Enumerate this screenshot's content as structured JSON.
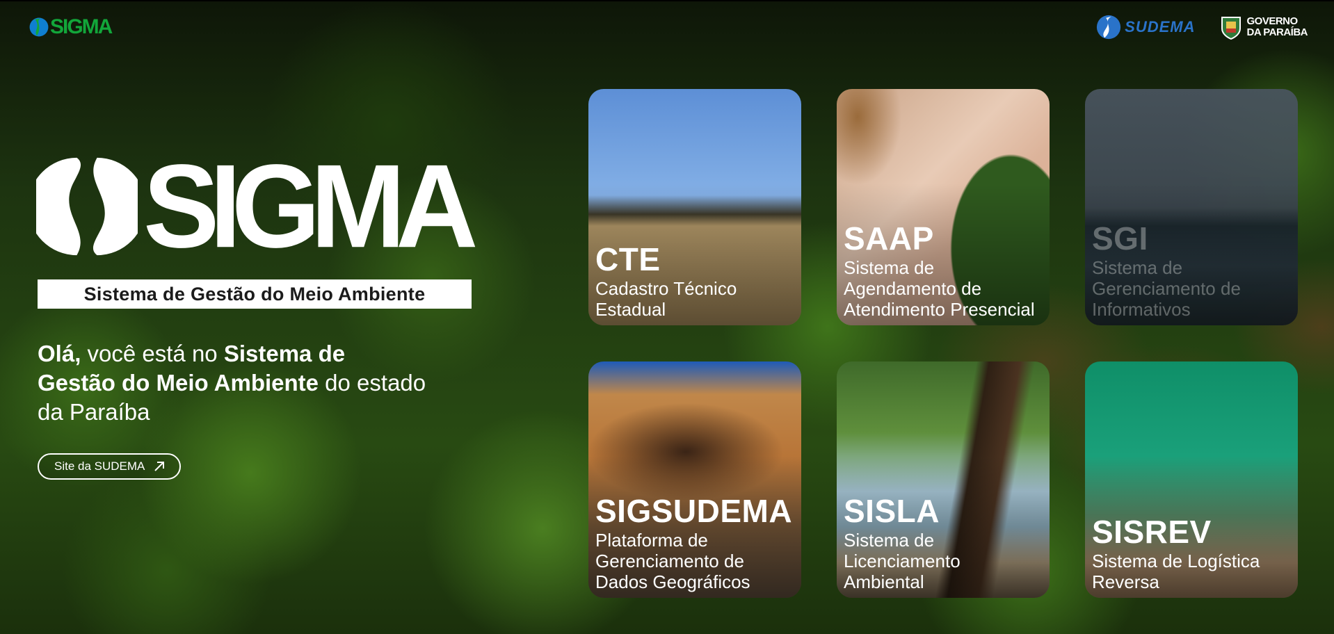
{
  "header": {
    "brand": "SIGMA",
    "partner_sudema": "SUDEMA",
    "partner_gov_line1": "GOVERNO",
    "partner_gov_line2": "DA PARAÍBA"
  },
  "hero": {
    "logo_text": "SIGMA",
    "tagline": "Sistema de Gestão do Meio Ambiente",
    "welcome_bold1": "Olá,",
    "welcome_text1": " você está no ",
    "welcome_bold2": "Sistema de Gestão do Meio Ambiente",
    "welcome_text2": " do estado da Paraíba",
    "site_button_label": "Site da SUDEMA"
  },
  "cards": [
    {
      "title": "CTE",
      "description": "Cadastro Técnico Estadual"
    },
    {
      "title": "SAAP",
      "description": "Sistema de Agendamento de Atendimento Presencial"
    },
    {
      "title": "SGI",
      "description": "Sistema de Gerenciamento de Informativos"
    },
    {
      "title": "SIGSUDEMA",
      "description": "Plataforma de Gerenciamento de Dados Geográficos"
    },
    {
      "title": "SISLA",
      "description": "Sistema de Licenciamento Ambiental"
    },
    {
      "title": "SISREV",
      "description": "Sistema de Logística Reversa"
    }
  ],
  "colors": {
    "brand_green": "#12a63a",
    "sudema_blue": "#2a73c9",
    "text_white": "#ffffff"
  }
}
